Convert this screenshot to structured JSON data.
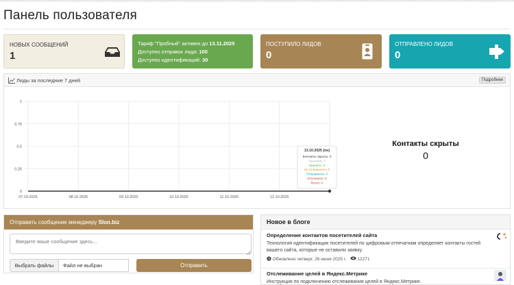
{
  "page": {
    "title": "Панель пользователя"
  },
  "cards": {
    "messages": {
      "label": "НОВЫХ СООБЩЕНИЙ",
      "value": "1",
      "icon": "inbox-icon"
    },
    "tariff": {
      "line1_prefix": "Тариф \"Пробный\" активен до ",
      "line1_date": "13.11.2025",
      "line2_prefix": "Доступно отправок лида: ",
      "line2_value": "100",
      "line3_prefix": "Доступно идентификаций: ",
      "line3_value": "30",
      "color": "#6aa84f"
    },
    "leads_in": {
      "label": "ПОСТУПИЛО ЛИДОВ",
      "value": "0",
      "icon": "contact-card-icon",
      "color": "#a88554"
    },
    "leads_out": {
      "label": "ОТПРАВЛЕНО ЛИДОВ",
      "value": "0",
      "icon": "signpost-icon",
      "color": "#17a5b0"
    }
  },
  "chart_panel": {
    "title": "Лиды за последние 7 дней",
    "more_label": "Подробнее"
  },
  "chart_data": {
    "type": "line",
    "x": [
      "07.10.2025",
      "08.10.2025",
      "09.10.2025",
      "10.10.2025",
      "11.10.2025",
      "12.10.2025",
      "13.10.2025"
    ],
    "x_tick_labels": [
      "07.10.2025",
      "08.10.2025",
      "09.10.2025",
      "10.10.2025",
      "11.10.2025",
      "12.10.2025"
    ],
    "series": [
      {
        "values": [
          0,
          0,
          0,
          0,
          0,
          0,
          0
        ],
        "color": "#333333"
      }
    ],
    "ylim": [
      0,
      1
    ],
    "y_ticks": [
      "0",
      "0.25",
      "0.5",
      "0.75",
      "1"
    ],
    "grid": true
  },
  "tooltip": {
    "title": "13.10.2025 (пн)",
    "rows": [
      {
        "text": "Контакты скрыты: 0",
        "color": "#333333"
      },
      {
        "text": "Черновик: 0",
        "color": "#bbbbbb"
      },
      {
        "text": "Принято: 0",
        "color": "#6aa84f"
      },
      {
        "text": "Не отправлено: 0",
        "color": "#e69138"
      },
      {
        "text": "Отправлено: 0",
        "color": "#17a5b0"
      },
      {
        "text": "Отклонено: 0",
        "color": "#cc4125"
      },
      {
        "text": "Всего: 0",
        "color": "#cc4125"
      }
    ]
  },
  "hidden_contacts": {
    "label": "Контакты скрыты",
    "value": "0"
  },
  "message_panel": {
    "header_prefix": "Отправить сообщение менеджеру ",
    "header_brand": "Slon.biz",
    "placeholder": "Введите ваше сообщение здесь...",
    "file_button": "Выбрать файлы",
    "file_name": "Файл не выбран",
    "send_button": "Отправить",
    "color": "#a88554"
  },
  "blog": {
    "title": "Новое в блоге",
    "posts": [
      {
        "title": "Определение контактов посетителей сайта",
        "desc": "Технология идентификации посетителей по цифровым отпечаткам определяет контакты гостей вашего сайта, которые не оставили заявку.",
        "updated": "Обновлено четверг, 26 июня 2025 г.",
        "views": "12271"
      },
      {
        "title": "Отслеживание целей в Яндекс.Метрике",
        "desc": "Инструкция по подключению отслеживания целей в Яндекс.Метрике."
      }
    ]
  }
}
